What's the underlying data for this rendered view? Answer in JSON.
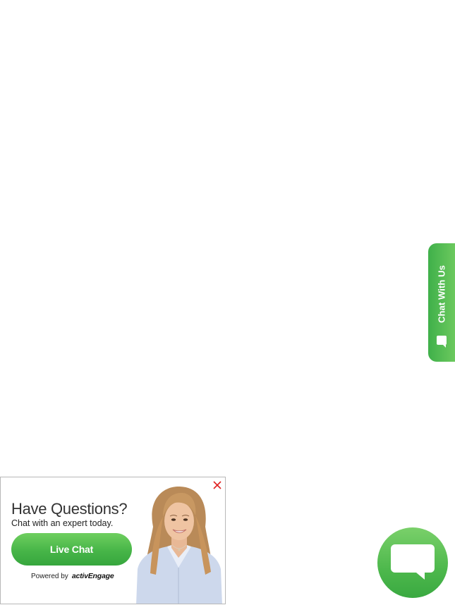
{
  "side_tab": {
    "label": "Chat With Us",
    "icon": "chat-bubble-icon"
  },
  "popup": {
    "title": "Have Questions?",
    "subtitle": "Chat with an expert today.",
    "button_label": "Live Chat",
    "powered_by_label": "Powered by",
    "brand": "activEngage",
    "close_icon": "close-icon",
    "agent_image": "support-agent-photo"
  },
  "fab": {
    "icon": "chat-bubble-icon"
  },
  "colors": {
    "accent_green": "#4db84c",
    "close_red": "#e02020",
    "text_dark": "#333333"
  }
}
